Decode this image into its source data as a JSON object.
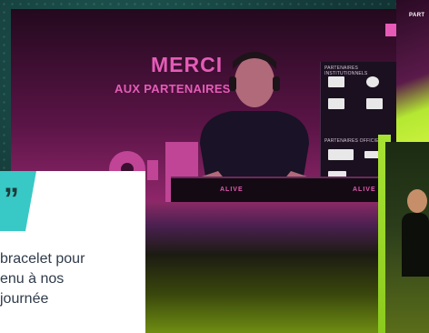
{
  "slide": {
    "headline_line1": "MERCI",
    "headline_line2": "AUX PARTENAIRES",
    "screen_section1": "PARTENAIRES INSTITUTIONNELS",
    "screen_section2": "PARTENAIRES OFFICIELS",
    "desk_label": "ALIVE",
    "right_top_text": "PART"
  },
  "card": {
    "badge_glyph": "”",
    "text_lines": [
      "bracelet pour",
      "enu à nos",
      "journée"
    ]
  },
  "colors": {
    "accent_pink": "#e45cb7",
    "accent_teal": "#38c8c6",
    "accent_green": "#a7e233"
  }
}
